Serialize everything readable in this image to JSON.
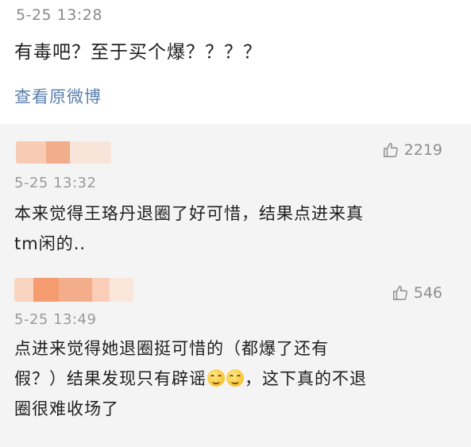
{
  "post": {
    "time": "5-25 13:28",
    "text": "有毒吧？至于买个爆？？？？",
    "view_original": "查看原微博"
  },
  "comments": [
    {
      "likes": "2219",
      "time": "5-25 13:32",
      "text_line1": "本来觉得王珞丹退圈了好可惜，结果点进来真",
      "text_line2": "tm闲的.."
    },
    {
      "likes": "546",
      "time": "5-25 13:49",
      "text_line1": "点进来觉得她退圈挺可惜的（都爆了还有",
      "text_line2_before_emoji": "假？）结果发现只有辟谣",
      "text_line2_after_emoji": "，这下真的不退",
      "text_line3": "圈很难收场了"
    }
  ],
  "icons": {
    "like": "thumbs-up-icon",
    "emoji": "smile-emoji-icon"
  },
  "colors": {
    "link": "#5b7fae",
    "comments_bg": "#f4f4f4",
    "muted_text": "#8a8a8a"
  }
}
